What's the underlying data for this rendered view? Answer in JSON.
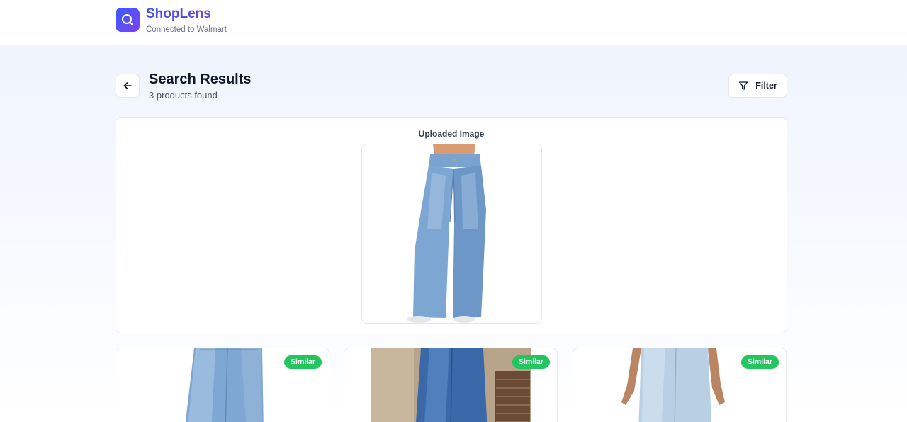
{
  "header": {
    "brand_name": "ShopLens",
    "subtitle": "Connected to Walmart",
    "logo_icon": "search-icon"
  },
  "page": {
    "back_icon": "arrow-left-icon",
    "title": "Search Results",
    "count_text": "3 products found",
    "filter_label": "Filter",
    "filter_icon": "filter-icon"
  },
  "upload": {
    "label": "Uploaded Image",
    "image_alt": "wide-leg light wash jeans"
  },
  "results": [
    {
      "badge": "Similar",
      "image_alt": "light wash baggy jeans"
    },
    {
      "badge": "Similar",
      "image_alt": "dark wash wide leg jeans"
    },
    {
      "badge": "Similar",
      "image_alt": "pale blue wide leg jeans"
    }
  ],
  "colors": {
    "brand_gradient_start": "#3b5bff",
    "brand_gradient_end": "#7a43f0",
    "badge_green": "#22c55e"
  }
}
